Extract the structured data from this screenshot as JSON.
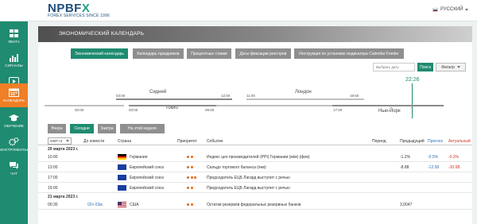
{
  "header": {
    "logo_main": "NPBF",
    "logo_x": "X",
    "logo_sub": "FOREX SERVICES SINCE 1996",
    "language": "РУССКИЙ"
  },
  "sidebar": {
    "items": [
      {
        "label": "ЛЕНТА",
        "icon": "grid-icon"
      },
      {
        "label": "СИГНАЛЫ",
        "icon": "bar-chart-icon"
      },
      {
        "label": "ВИДЕО",
        "icon": "play-icon"
      },
      {
        "label": "КАЛЕНДАРЬ",
        "icon": "calendar-icon",
        "active": true
      },
      {
        "label": "ОБУЧЕНИЕ",
        "icon": "graduation-cap-icon"
      },
      {
        "label": "ИНСТРУМЕНТЫ",
        "icon": "gears-icon"
      },
      {
        "label": "ЧАТ",
        "icon": "chat-icon"
      }
    ]
  },
  "page_title": "ЭКОНОМИЧЕСКИЙ КАЛЕНДАРЬ",
  "tabs": [
    {
      "label": "Экономический календарь",
      "active": true
    },
    {
      "label": "Календарь праздников"
    },
    {
      "label": "Процентные ставки"
    },
    {
      "label": "Даты фиксации реестров"
    },
    {
      "label": "Инструкция по установке индикатора Calendar Feeder"
    }
  ],
  "filters": {
    "date_placeholder": "Выбрать дату",
    "search_label": "Поиск",
    "filter_label": "Фильтр"
  },
  "timeline": {
    "now": "22:26",
    "sessions": [
      {
        "city": "Сидней",
        "start": "03:00",
        "end": "12:00"
      },
      {
        "city": "Токио",
        "start": "03:00",
        "end": "09:00"
      },
      {
        "city": "Лондон",
        "start": "11:00",
        "end": "19:50"
      },
      {
        "city": "Нью-Йорк",
        "start": "17:00",
        "end": ""
      }
    ],
    "tokyo_start_extra": "00:00"
  },
  "day_buttons": [
    {
      "label": "Вчера"
    },
    {
      "label": "Сегодня",
      "active": true
    },
    {
      "label": "Завтра"
    },
    {
      "label": "На этой неделе"
    }
  ],
  "table": {
    "timezone": "GMT+3",
    "headers": {
      "until_news": "До новости",
      "country": "Страна",
      "priority": "Приоритет",
      "event": "Событие",
      "period": "Период",
      "previous": "Предыдущий",
      "forecast": "Прогноз",
      "actual": "Актуальный"
    },
    "groups": [
      {
        "date": "20 марта 2023 г.",
        "rows": [
          {
            "time": "10:00",
            "until": "",
            "country": "Германия",
            "flag": "de",
            "priority": 2,
            "event": "Индекс цен производителей (PPI) Германии (м/м) (фев)",
            "period": "",
            "previous": "-1.2%",
            "forecast": "-0.5%",
            "actual": "-0.3%"
          },
          {
            "time": "13:00",
            "until": "",
            "country": "Европейский союз",
            "flag": "eu",
            "priority": 2,
            "event": "Сальдо торгового баланса (янв)",
            "period": "",
            "previous": "-8.88",
            "forecast": "-12.58",
            "actual": "-30.6B"
          },
          {
            "time": "17:00",
            "until": "",
            "country": "Европейский союз",
            "flag": "eu",
            "priority": 3,
            "event": "Председатель ЕЦБ Лагард выступит с речью",
            "period": "",
            "previous": "",
            "forecast": "",
            "actual": ""
          },
          {
            "time": "19:00",
            "until": "",
            "country": "Европейский союз",
            "flag": "eu",
            "priority": 2,
            "event": "Председатель ЕЦБ Лагард выступит с речью",
            "period": "",
            "previous": "",
            "forecast": "",
            "actual": ""
          }
        ]
      },
      {
        "date": "21 марта 2023 г.",
        "rows": [
          {
            "time": "00:30",
            "until": "02ч 03м.",
            "country": "США",
            "flag": "us",
            "priority": 2,
            "event": "Остатки резервов федеральных резервных банков",
            "period": "",
            "previous": "3,0047",
            "forecast": "",
            "actual": ""
          }
        ]
      }
    ]
  },
  "colors": {
    "primary": "#1f8b70",
    "active_sidebar": "#f07f25",
    "priority_dot": "#e06a1f",
    "forecast_text": "#2f6fb5",
    "actual_text": "#d0352b"
  }
}
